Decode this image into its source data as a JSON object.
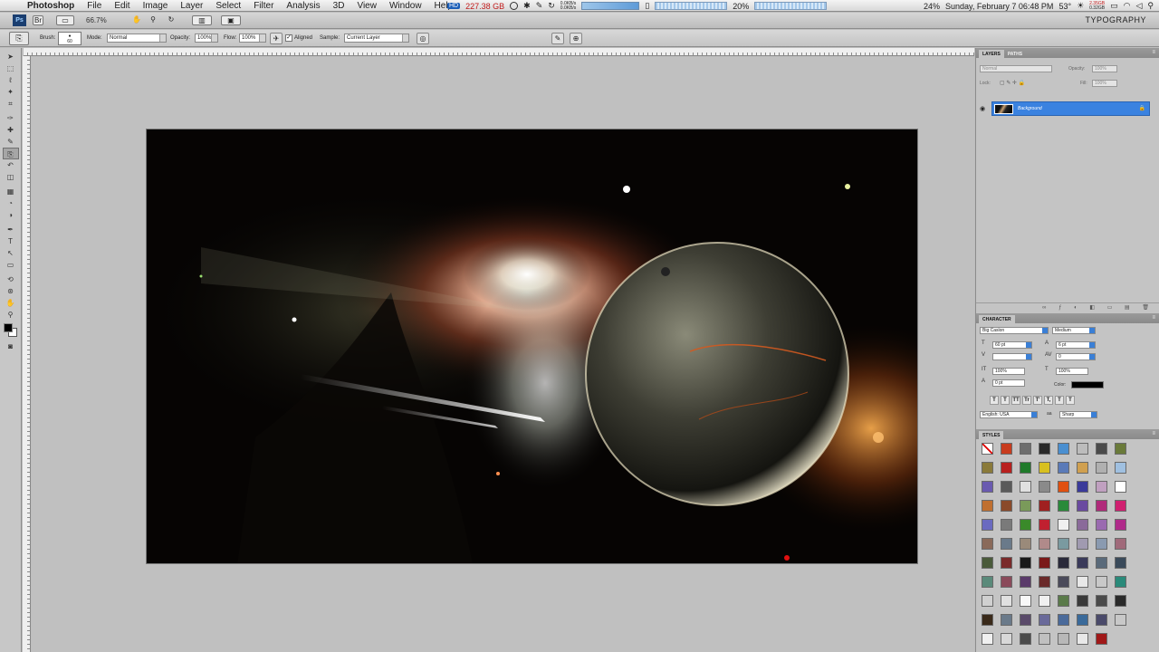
{
  "menubar": {
    "apple": "",
    "app_name": "Photoshop",
    "items": [
      "File",
      "Edit",
      "Image",
      "Layer",
      "Select",
      "Filter",
      "Analysis",
      "3D",
      "View",
      "Window",
      "Help"
    ],
    "disk_badge": "HD",
    "disk_free": "227.38 GB",
    "net_rates": [
      "0.0KB/s",
      "0.0KB/s"
    ],
    "cpu_percent": "20%",
    "mem_percent": "24%",
    "clock": "Sunday, February 7 06:48 PM",
    "temp": "53°",
    "mem_small": [
      "2.35GB",
      "0.32GB"
    ]
  },
  "appbar": {
    "logo": "Ps",
    "zoom": "66.7%",
    "workspace": "TYPOGRAPHY"
  },
  "options": {
    "brush_label": "Brush:",
    "brush_size": "60",
    "mode_label": "Mode:",
    "mode_value": "Normal",
    "opacity_label": "Opacity:",
    "opacity_value": "100%",
    "flow_label": "Flow:",
    "flow_value": "100%",
    "aligned_label": "Aligned",
    "sample_label": "Sample:",
    "sample_value": "Current Layer"
  },
  "toolbox": {
    "tools": [
      "move-tool",
      "marquee-tool",
      "lasso-tool",
      "magic-wand-tool",
      "crop-tool",
      "eyedropper-tool",
      "healing-brush-tool",
      "brush-tool",
      "clone-stamp-tool",
      "history-brush-tool",
      "eraser-tool",
      "gradient-tool",
      "blur-tool",
      "dodge-tool",
      "pen-tool",
      "type-tool",
      "path-selection-tool",
      "shape-tool",
      "3d-rotate-tool",
      "3d-orbit-tool",
      "hand-tool",
      "zoom-tool"
    ],
    "active_index": 8,
    "foreground_color": "#000000",
    "background_color": "#ffffff"
  },
  "layers_panel": {
    "tabs": [
      "LAYERS",
      "PATHS"
    ],
    "blend_mode": "Normal",
    "opacity_label": "Opacity:",
    "opacity_value": "100%",
    "lock_label": "Lock:",
    "fill_label": "Fill:",
    "fill_value": "100%",
    "layers": [
      {
        "name": "Background",
        "visible": true,
        "locked": true,
        "selected": true
      }
    ],
    "selection_color": "#3a82e0"
  },
  "character_panel": {
    "tab": "CHARACTER",
    "font_family": "Big Caslon",
    "font_style": "Medium",
    "font_size": "60 pt",
    "leading": "6 pt",
    "tracking": "0",
    "vertical_scale": "100%",
    "horizontal_scale": "100%",
    "baseline_shift": "0 pt",
    "color_label": "Color:",
    "text_color": "#000000",
    "language": "English: USA",
    "aa_label": "aa",
    "antialias": "Sharp",
    "style_buttons": [
      "T",
      "T",
      "TT",
      "Tr",
      "T'",
      "T,",
      "T",
      "T"
    ]
  },
  "styles_panel": {
    "tab": "STYLES",
    "swatches": [
      "#f4f4f4",
      "#c83c1e",
      "#6e6e6e",
      "#2a2a2a",
      "#4a8fd0",
      "#bcbcbc",
      "#4a4a4a",
      "#6a7a3a",
      "#8a7a3a",
      "#b8201e",
      "#1f7a2a",
      "#d8c020",
      "#5a7ab8",
      "#d0a050",
      "#b0b0b0",
      "#a0c0e0",
      "#6a5ab0",
      "#5a5a5a",
      "#e0e0e0",
      "#8a8a8a",
      "#e05010",
      "#3a3a9a",
      "#c0a0c0",
      "#ffffff",
      "#c07030",
      "#8a4a2a",
      "#7a9a5a",
      "#a02020",
      "#2a8a3a",
      "#6a4aa0",
      "#b02a7a",
      "#d02070",
      "#6a6ac0",
      "#7a7a7a",
      "#3a8a2a",
      "#c02030",
      "#f0f0f0",
      "#8a6a9a",
      "#9a6ab0",
      "#b02a8a",
      "#8a6a5a",
      "#6a7a8a",
      "#9a8a7a",
      "#b08a8a",
      "#7a9aa0",
      "#a09ab0",
      "#8a9ab0",
      "#a06a7a",
      "#4a5a3a",
      "#7a2a2a",
      "#1a1a1a",
      "#7a1a1a",
      "#2a2a3a",
      "#3a3a5a",
      "#5a6a7a",
      "#3a4a5a",
      "#5a8a7a",
      "#8a4a5a",
      "#5a3a6a",
      "#6a2a2a",
      "#4a4a5a",
      "#e8e8e8",
      "#c8c8c8",
      "#2a8a7a",
      "#d0d0d0",
      "#e0e0e0",
      "#f8f8f8",
      "#f0f0f0",
      "#5a7a4a",
      "#3a3a3a",
      "#4a4a4a",
      "#2a2a2a",
      "#3a2a1a",
      "#6a7a8a",
      "#5a4a6a",
      "#6a6a9a",
      "#4a6a9a",
      "#3a6a9a",
      "#4a4a6a",
      "#c8c8c8",
      "#f0f0f0",
      "#d8d8d8",
      "#4a4a4a",
      "#c0c0c0",
      "#b8b8b8",
      "#e8e8e8",
      "#a01818"
    ]
  }
}
